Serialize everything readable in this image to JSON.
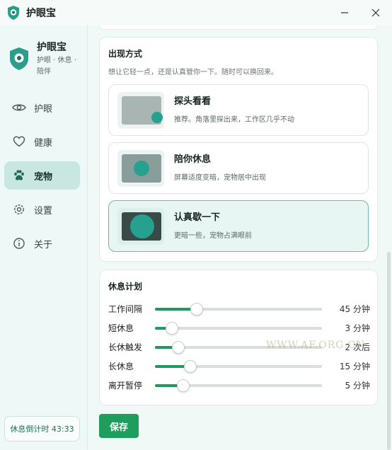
{
  "window": {
    "title": "护眼宝"
  },
  "brand": {
    "name": "护眼宝",
    "subtitle": "护眼 · 休息 · 陪伴"
  },
  "nav": [
    {
      "label": "护眼",
      "icon": "eye-icon"
    },
    {
      "label": "健康",
      "icon": "heart-icon"
    },
    {
      "label": "宠物",
      "icon": "paw-icon",
      "active": true
    },
    {
      "label": "设置",
      "icon": "gear-icon"
    },
    {
      "label": "关于",
      "icon": "info-icon"
    }
  ],
  "countdown": "休息倒计时 43:33",
  "display": {
    "title": "出现方式",
    "desc": "想让它轻一点，还是认真管你一下。随时可以换回来。",
    "options": [
      {
        "title": "探头看看",
        "desc": "推荐。角落里探出来，工作区几乎不动",
        "selected": false
      },
      {
        "title": "陪你休息",
        "desc": "屏幕适度变暗，宠物居中出现",
        "selected": false
      },
      {
        "title": "认真歇一下",
        "desc": "更暗一些，宠物占满眼前",
        "selected": true
      }
    ]
  },
  "plan": {
    "title": "休息计划",
    "rows": [
      {
        "label": "工作间隔",
        "value": "45 分钟",
        "level": 0.25
      },
      {
        "label": "短休息",
        "value": "3 分钟",
        "level": 0.1
      },
      {
        "label": "长休触发",
        "value": "2 次后",
        "level": 0.14
      },
      {
        "label": "长休息",
        "value": "15 分钟",
        "level": 0.21
      },
      {
        "label": "离开暂停",
        "value": "5 分钟",
        "level": 0.17
      }
    ]
  },
  "save_label": "保存",
  "watermark": "WWW.AF.ORG.CN",
  "colors": {
    "accent": "#1f9d5c",
    "teal": "#26a08f",
    "sidebar_bg": "#eef8f6"
  }
}
